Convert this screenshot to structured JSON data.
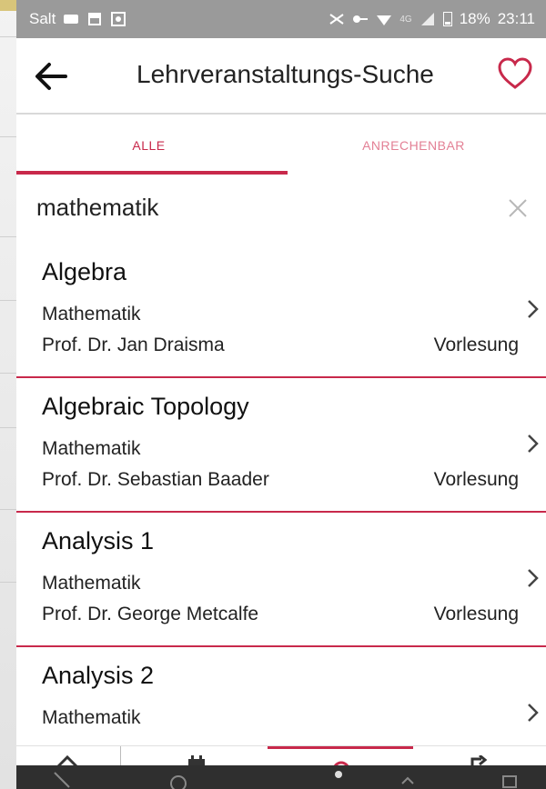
{
  "status_bar": {
    "carrier": "Salt",
    "network": "4G",
    "battery": "18%",
    "time": "23:11"
  },
  "app_bar": {
    "title": "Lehrveranstaltungs-Suche",
    "back_icon": "arrow-left-icon",
    "favorite_icon": "heart-outline-icon"
  },
  "tabs": [
    {
      "label": "ALLE",
      "active": true
    },
    {
      "label": "ANRECHENBAR",
      "active": false
    }
  ],
  "search": {
    "value": "mathematik",
    "clear_icon": "close-icon"
  },
  "results": [
    {
      "title": "Algebra",
      "subject": "Mathematik",
      "lecturer": "Prof. Dr. Jan Draisma",
      "type": "Vorlesung"
    },
    {
      "title": "Algebraic Topology",
      "subject": "Mathematik",
      "lecturer": "Prof. Dr. Sebastian Baader",
      "type": "Vorlesung"
    },
    {
      "title": "Analysis 1",
      "subject": "Mathematik",
      "lecturer": "Prof. Dr. George Metcalfe",
      "type": "Vorlesung"
    },
    {
      "title": "Analysis 2",
      "subject": "Mathematik",
      "lecturer": "",
      "type": ""
    }
  ],
  "bottom_nav": [
    {
      "icon": "home-icon",
      "active": false
    },
    {
      "icon": "calendar-icon",
      "active": false
    },
    {
      "icon": "search-icon",
      "active": true
    },
    {
      "icon": "logout-icon",
      "active": false
    }
  ],
  "colors": {
    "accent": "#c8294b",
    "status_bar": "#9a9a9a"
  }
}
